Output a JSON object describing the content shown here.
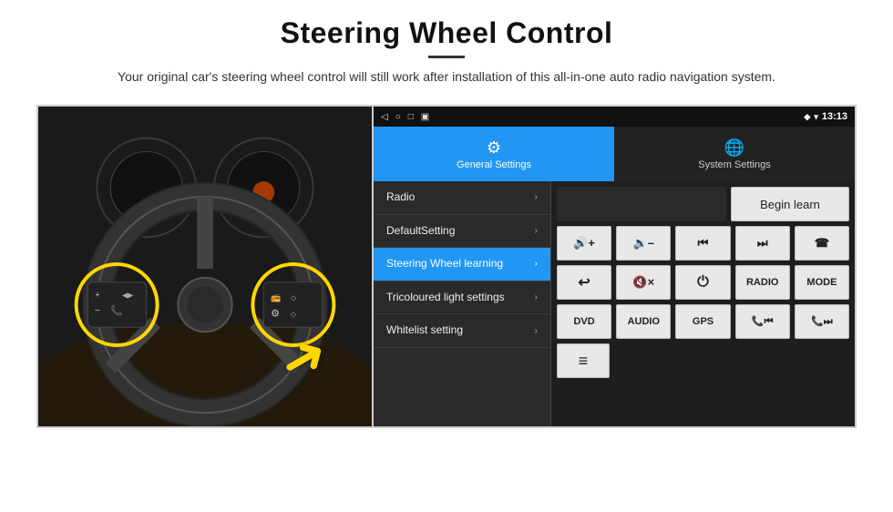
{
  "page": {
    "title": "Steering Wheel Control",
    "divider": true,
    "subtitle": "Your original car's steering wheel control will still work after installation of this all-in-one auto radio navigation system."
  },
  "status_bar": {
    "icons": [
      "◁",
      "○",
      "□",
      "▣"
    ],
    "location_icon": "◆",
    "wifi_icon": "▾",
    "time": "13:13"
  },
  "tabs": [
    {
      "id": "general",
      "label": "General Settings",
      "active": true,
      "icon": "⚙"
    },
    {
      "id": "system",
      "label": "System Settings",
      "active": false,
      "icon": "🌐"
    }
  ],
  "menu": [
    {
      "id": "radio",
      "label": "Radio",
      "active": false
    },
    {
      "id": "default-setting",
      "label": "DefaultSetting",
      "active": false
    },
    {
      "id": "steering-wheel",
      "label": "Steering Wheel learning",
      "active": true
    },
    {
      "id": "tricoloured",
      "label": "Tricoloured light settings",
      "active": false
    },
    {
      "id": "whitelist",
      "label": "Whitelist setting",
      "active": false
    }
  ],
  "right_panel": {
    "begin_learn_label": "Begin learn",
    "button_rows": [
      [
        {
          "id": "vol-up",
          "label": "🔊+",
          "type": "icon"
        },
        {
          "id": "vol-down",
          "label": "🔉–",
          "type": "icon"
        },
        {
          "id": "prev",
          "label": "⏮",
          "type": "icon"
        },
        {
          "id": "next",
          "label": "⏭",
          "type": "icon"
        },
        {
          "id": "phone",
          "label": "☎",
          "type": "icon"
        }
      ],
      [
        {
          "id": "hangup",
          "label": "↩",
          "type": "icon"
        },
        {
          "id": "mute-x",
          "label": "🔇×",
          "type": "icon"
        },
        {
          "id": "power",
          "label": "⏻",
          "type": "icon"
        },
        {
          "id": "radio-btn",
          "label": "RADIO",
          "type": "text"
        },
        {
          "id": "mode-btn",
          "label": "MODE",
          "type": "text"
        }
      ],
      [
        {
          "id": "dvd-btn",
          "label": "DVD",
          "type": "text"
        },
        {
          "id": "audio-btn",
          "label": "AUDIO",
          "type": "text"
        },
        {
          "id": "gps-btn",
          "label": "GPS",
          "type": "text"
        },
        {
          "id": "phone-prev",
          "label": "📞⏮",
          "type": "icon"
        },
        {
          "id": "phone-next",
          "label": "📞⏭",
          "type": "icon"
        }
      ]
    ],
    "last_row": [
      {
        "id": "list-icon",
        "label": "≡",
        "type": "icon"
      }
    ]
  }
}
